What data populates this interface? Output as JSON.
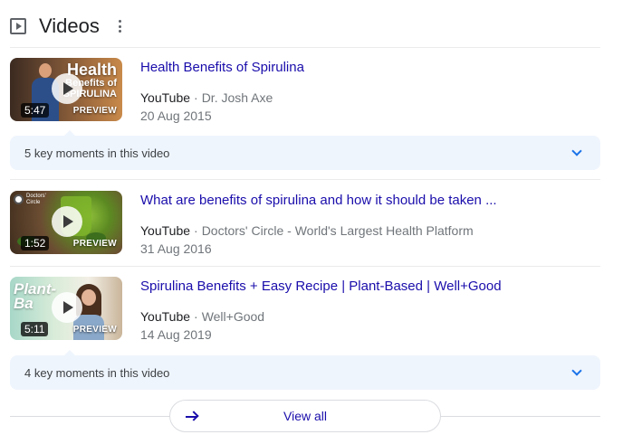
{
  "header": {
    "title": "Videos",
    "icon": "video-icon",
    "menu_icon": "more-vert-icon"
  },
  "videos": [
    {
      "title": "Health Benefits of Spirulina",
      "platform": "YouTube",
      "channel": "Dr. Josh Axe",
      "date": "20 Aug 2015",
      "duration": "5:47",
      "preview_label": "PREVIEW",
      "thumb_text_big": "Health",
      "thumb_text_small1": "Benefits of",
      "thumb_text_small2": "SPIRULINA"
    },
    {
      "title": "What are benefits of spirulina and how it should be taken ...",
      "platform": "YouTube",
      "channel": "Doctors' Circle - World's Largest Health Platform",
      "date": "31 Aug 2016",
      "duration": "1:52",
      "preview_label": "PREVIEW",
      "thumb_text_small1": "Doctors'",
      "thumb_text_small2": "Circle"
    },
    {
      "title": "Spirulina Benefits + Easy Recipe | Plant-Based | Well+Good",
      "platform": "YouTube",
      "channel": "Well+Good",
      "date": "14 Aug 2019",
      "duration": "5:11",
      "preview_label": "PREVIEW",
      "thumb_text_big": "Plant-",
      "thumb_text_small1": "Ba"
    }
  ],
  "key_moments": [
    {
      "label": "5 key moments in this video"
    },
    {
      "label": "4 key moments in this video"
    }
  ],
  "separator": "·",
  "view_all": {
    "label": "View all"
  },
  "colors": {
    "link": "#1a0dab",
    "meta": "#70757a",
    "key_moments_bg": "#eff5fd",
    "chevron": "#1a73e8"
  }
}
